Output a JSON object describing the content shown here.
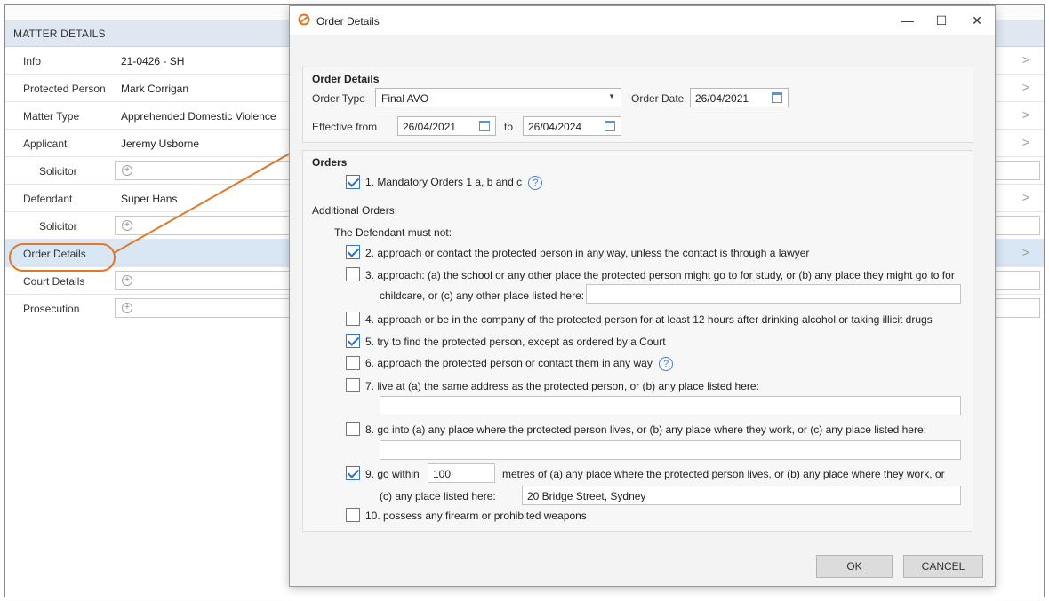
{
  "background": {
    "section_title": "MATTER DETAILS",
    "rows": [
      {
        "label": "Info",
        "value": "21-0426 - SH"
      },
      {
        "label": "Protected Person",
        "value": "Mark Corrigan"
      },
      {
        "label": "Matter Type",
        "value": "Apprehended Domestic Violence"
      },
      {
        "label": "Applicant",
        "value": "Jeremy Usborne"
      },
      {
        "label": "Solicitor",
        "value": ""
      },
      {
        "label": "Defendant",
        "value": "Super Hans"
      },
      {
        "label": "Solicitor",
        "value": ""
      },
      {
        "label": "Order Details",
        "value": ""
      },
      {
        "label": "Court Details",
        "value": ""
      },
      {
        "label": "Prosecution",
        "value": ""
      }
    ],
    "plus_glyph": "+",
    "chevron_glyph": ">"
  },
  "dialog": {
    "title": "Order Details",
    "minimize_glyph": "—",
    "maximize_glyph": "☐",
    "close_glyph": "✕",
    "details_group": {
      "title": "Order Details",
      "order_type_label": "Order Type",
      "order_type_value": "Final AVO",
      "order_date_label": "Order Date",
      "order_date_value": "26/04/2021",
      "effective_from_label": "Effective from",
      "effective_from_value": "26/04/2021",
      "to_label": "to",
      "to_value": "26/04/2024"
    },
    "orders_group": {
      "title": "Orders",
      "mandatory": {
        "text": "1. Mandatory Orders 1 a, b and c",
        "checked": true
      },
      "additional_label": "Additional Orders:",
      "must_not_label": "The Defendant must not:",
      "items": [
        {
          "text": "2. approach or contact the protected person in any way, unless the contact is through a lawyer",
          "checked": true
        },
        {
          "text": "3. approach: (a) the school or any other place the protected person might go to for study, or (b) any place they might go to for",
          "text2": "childcare, or (c) any other place listed here:",
          "checked": false,
          "input": ""
        },
        {
          "text": "4. approach or be in the company of the protected person for at least 12 hours after drinking alcohol or taking illicit drugs",
          "checked": false
        },
        {
          "text": "5. try to find the protected person, except as ordered by a Court",
          "checked": true
        },
        {
          "text": "6. approach the protected person or contact them in any way",
          "checked": false
        },
        {
          "text": "7. live at (a) the same address as the protected person, or (b) any place listed here:",
          "checked": false,
          "input": ""
        },
        {
          "text": "8. go into (a) any place where the protected person lives, or (b) any place where they work, or (c) any place listed here:",
          "checked": false,
          "input": ""
        },
        {
          "text_prefix": "9. go within",
          "metres_value": "100",
          "text_suffix": "metres of (a) any place where the protected person lives, or (b) any place where they work, or",
          "text2": "(c) any place listed here:",
          "checked": true,
          "input": "20 Bridge Street, Sydney"
        },
        {
          "text": "10. possess any firearm or prohibited weapons",
          "checked": false
        }
      ]
    },
    "ok_label": "OK",
    "cancel_label": "CANCEL"
  },
  "colors": {
    "accent": "#e0782a",
    "selected_row": "#d9e6f4",
    "checkbox": "#2e6fc2"
  }
}
